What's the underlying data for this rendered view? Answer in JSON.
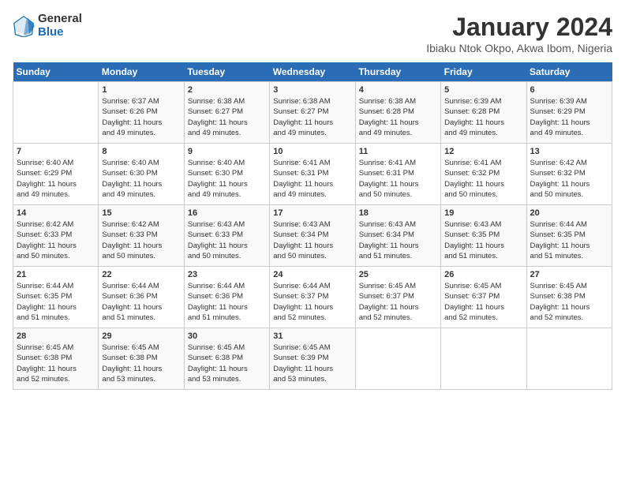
{
  "logo": {
    "general": "General",
    "blue": "Blue"
  },
  "header": {
    "title": "January 2024",
    "subtitle": "Ibiaku Ntok Okpo, Akwa Ibom, Nigeria"
  },
  "weekdays": [
    "Sunday",
    "Monday",
    "Tuesday",
    "Wednesday",
    "Thursday",
    "Friday",
    "Saturday"
  ],
  "weeks": [
    [
      {
        "day": "",
        "info": ""
      },
      {
        "day": "1",
        "info": "Sunrise: 6:37 AM\nSunset: 6:26 PM\nDaylight: 11 hours\nand 49 minutes."
      },
      {
        "day": "2",
        "info": "Sunrise: 6:38 AM\nSunset: 6:27 PM\nDaylight: 11 hours\nand 49 minutes."
      },
      {
        "day": "3",
        "info": "Sunrise: 6:38 AM\nSunset: 6:27 PM\nDaylight: 11 hours\nand 49 minutes."
      },
      {
        "day": "4",
        "info": "Sunrise: 6:38 AM\nSunset: 6:28 PM\nDaylight: 11 hours\nand 49 minutes."
      },
      {
        "day": "5",
        "info": "Sunrise: 6:39 AM\nSunset: 6:28 PM\nDaylight: 11 hours\nand 49 minutes."
      },
      {
        "day": "6",
        "info": "Sunrise: 6:39 AM\nSunset: 6:29 PM\nDaylight: 11 hours\nand 49 minutes."
      }
    ],
    [
      {
        "day": "7",
        "info": "Sunrise: 6:40 AM\nSunset: 6:29 PM\nDaylight: 11 hours\nand 49 minutes."
      },
      {
        "day": "8",
        "info": "Sunrise: 6:40 AM\nSunset: 6:30 PM\nDaylight: 11 hours\nand 49 minutes."
      },
      {
        "day": "9",
        "info": "Sunrise: 6:40 AM\nSunset: 6:30 PM\nDaylight: 11 hours\nand 49 minutes."
      },
      {
        "day": "10",
        "info": "Sunrise: 6:41 AM\nSunset: 6:31 PM\nDaylight: 11 hours\nand 49 minutes."
      },
      {
        "day": "11",
        "info": "Sunrise: 6:41 AM\nSunset: 6:31 PM\nDaylight: 11 hours\nand 50 minutes."
      },
      {
        "day": "12",
        "info": "Sunrise: 6:41 AM\nSunset: 6:32 PM\nDaylight: 11 hours\nand 50 minutes."
      },
      {
        "day": "13",
        "info": "Sunrise: 6:42 AM\nSunset: 6:32 PM\nDaylight: 11 hours\nand 50 minutes."
      }
    ],
    [
      {
        "day": "14",
        "info": "Sunrise: 6:42 AM\nSunset: 6:33 PM\nDaylight: 11 hours\nand 50 minutes."
      },
      {
        "day": "15",
        "info": "Sunrise: 6:42 AM\nSunset: 6:33 PM\nDaylight: 11 hours\nand 50 minutes."
      },
      {
        "day": "16",
        "info": "Sunrise: 6:43 AM\nSunset: 6:33 PM\nDaylight: 11 hours\nand 50 minutes."
      },
      {
        "day": "17",
        "info": "Sunrise: 6:43 AM\nSunset: 6:34 PM\nDaylight: 11 hours\nand 50 minutes."
      },
      {
        "day": "18",
        "info": "Sunrise: 6:43 AM\nSunset: 6:34 PM\nDaylight: 11 hours\nand 51 minutes."
      },
      {
        "day": "19",
        "info": "Sunrise: 6:43 AM\nSunset: 6:35 PM\nDaylight: 11 hours\nand 51 minutes."
      },
      {
        "day": "20",
        "info": "Sunrise: 6:44 AM\nSunset: 6:35 PM\nDaylight: 11 hours\nand 51 minutes."
      }
    ],
    [
      {
        "day": "21",
        "info": "Sunrise: 6:44 AM\nSunset: 6:35 PM\nDaylight: 11 hours\nand 51 minutes."
      },
      {
        "day": "22",
        "info": "Sunrise: 6:44 AM\nSunset: 6:36 PM\nDaylight: 11 hours\nand 51 minutes."
      },
      {
        "day": "23",
        "info": "Sunrise: 6:44 AM\nSunset: 6:36 PM\nDaylight: 11 hours\nand 51 minutes."
      },
      {
        "day": "24",
        "info": "Sunrise: 6:44 AM\nSunset: 6:37 PM\nDaylight: 11 hours\nand 52 minutes."
      },
      {
        "day": "25",
        "info": "Sunrise: 6:45 AM\nSunset: 6:37 PM\nDaylight: 11 hours\nand 52 minutes."
      },
      {
        "day": "26",
        "info": "Sunrise: 6:45 AM\nSunset: 6:37 PM\nDaylight: 11 hours\nand 52 minutes."
      },
      {
        "day": "27",
        "info": "Sunrise: 6:45 AM\nSunset: 6:38 PM\nDaylight: 11 hours\nand 52 minutes."
      }
    ],
    [
      {
        "day": "28",
        "info": "Sunrise: 6:45 AM\nSunset: 6:38 PM\nDaylight: 11 hours\nand 52 minutes."
      },
      {
        "day": "29",
        "info": "Sunrise: 6:45 AM\nSunset: 6:38 PM\nDaylight: 11 hours\nand 53 minutes."
      },
      {
        "day": "30",
        "info": "Sunrise: 6:45 AM\nSunset: 6:38 PM\nDaylight: 11 hours\nand 53 minutes."
      },
      {
        "day": "31",
        "info": "Sunrise: 6:45 AM\nSunset: 6:39 PM\nDaylight: 11 hours\nand 53 minutes."
      },
      {
        "day": "",
        "info": ""
      },
      {
        "day": "",
        "info": ""
      },
      {
        "day": "",
        "info": ""
      }
    ]
  ]
}
